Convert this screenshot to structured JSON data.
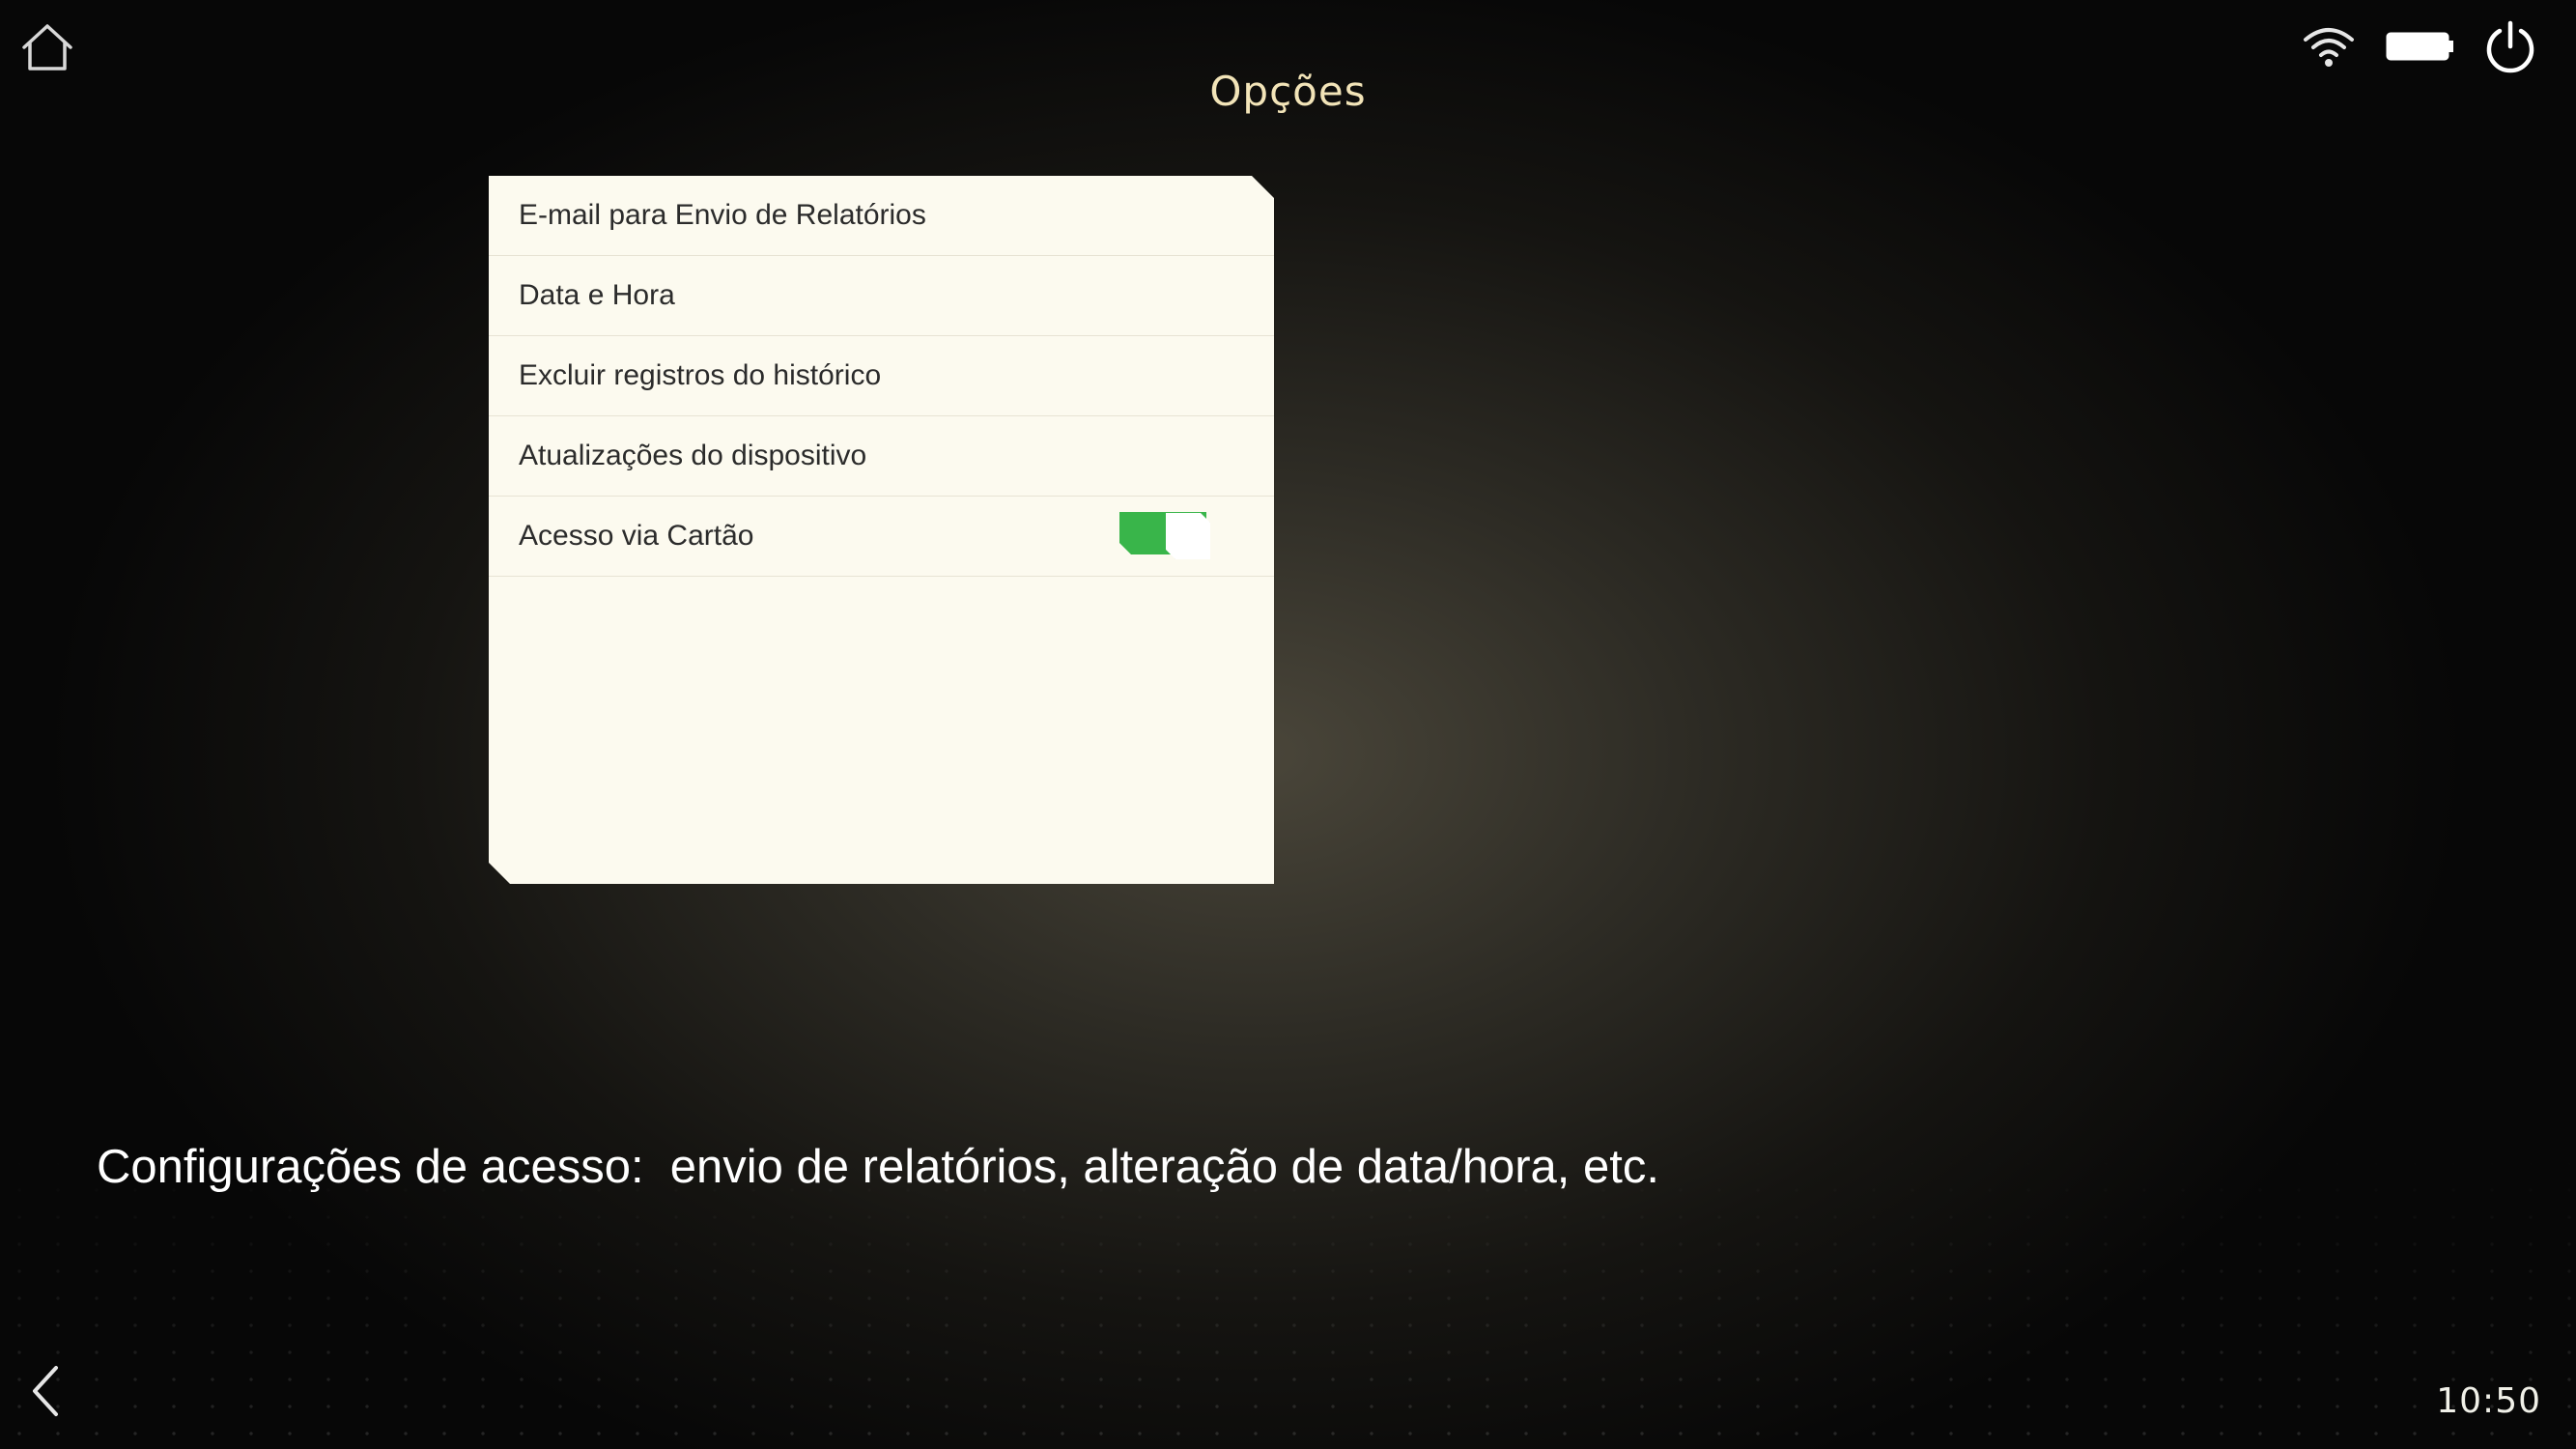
{
  "header": {
    "title": "Opções"
  },
  "status_icons": {
    "home": "home-icon",
    "wifi": "wifi-icon",
    "battery": "battery-icon",
    "power": "power-icon",
    "back": "chevron-left-icon"
  },
  "menu": {
    "items": [
      {
        "label": "E-mail para Envio de Relatórios"
      },
      {
        "label": "Data e Hora"
      },
      {
        "label": "Excluir registros do histórico"
      },
      {
        "label": "Atualizações do dispositivo"
      },
      {
        "label": "Acesso via Cartão",
        "toggle_on": true
      }
    ]
  },
  "caption": "Configurações de acesso:  envio de relatórios, alteração de data/hora, etc.",
  "footer": {
    "clock": "10:50"
  },
  "colors": {
    "title": "#f2e4b8",
    "panel": "#fcfaef",
    "toggle_on": "#39b54a"
  }
}
